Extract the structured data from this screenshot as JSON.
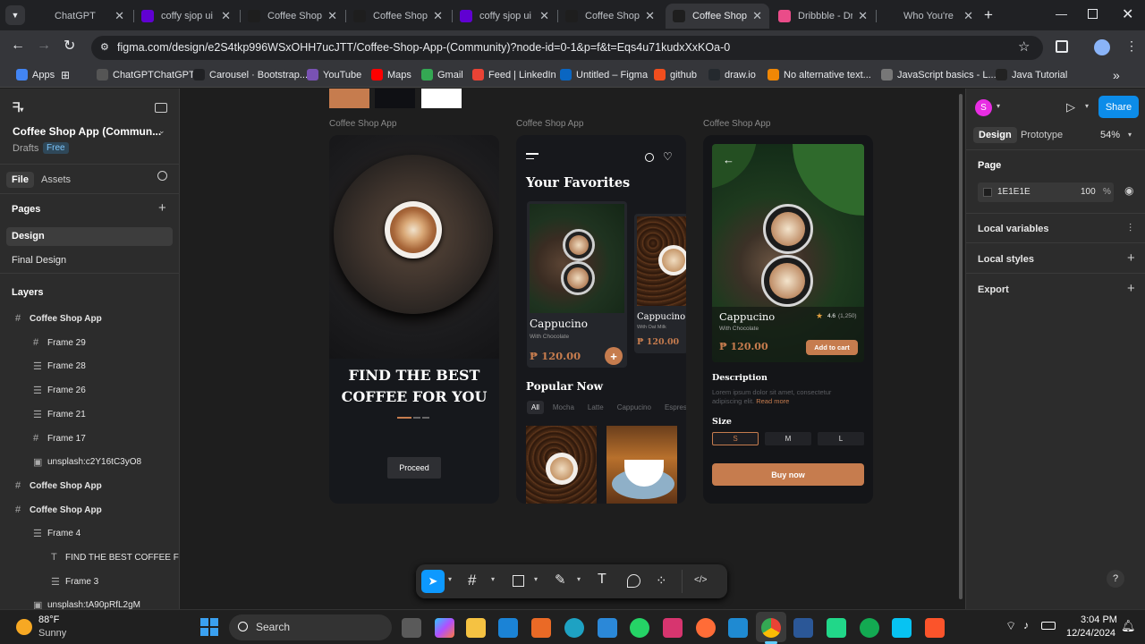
{
  "browser": {
    "tabs": [
      {
        "title": "ChatGPT",
        "color": "#202124"
      },
      {
        "title": "coffy sjop ui",
        "color": "#6001d2"
      },
      {
        "title": "Coffee Shop",
        "color": "#1e1e1e"
      },
      {
        "title": "Coffee Shop",
        "color": "#1e1e1e"
      },
      {
        "title": "coffy sjop ui",
        "color": "#6001d2"
      },
      {
        "title": "Coffee Shop",
        "color": "#1e1e1e"
      },
      {
        "title": "Coffee Shop",
        "color": "#1e1e1e"
      },
      {
        "title": "Dribbble - Dr",
        "color": "#ea4c89"
      },
      {
        "title": "Who You're",
        "color": "#202124"
      }
    ],
    "active_tab": 6,
    "url": "figma.com/design/e2S4tkp996WSxOHH7ucJTT/Coffee-Shop-App-(Community)?node-id=0-1&p=f&t=Eqs4u71kudxXxKOa-0",
    "bookmarks": [
      "Apps",
      "ChatGPTChatGPT",
      "Carousel · Bootstrap...",
      "YouTube",
      "Maps",
      "Gmail",
      "Feed | LinkedIn",
      "Untitled – Figma",
      "github",
      "draw.io",
      "No alternative text...",
      "JavaScript basics - L...",
      "Java Tutorial"
    ],
    "more": "»"
  },
  "left": {
    "file_title": "Coffee Shop App (Commun...",
    "drafts": "Drafts",
    "plan": "Free",
    "tab_file": "File",
    "tab_assets": "Assets",
    "pages_heading": "Pages",
    "pages": [
      "Design",
      "Final Design"
    ],
    "layers_heading": "Layers",
    "layers": [
      {
        "name": "Coffee Shop App",
        "type": "frame",
        "level": 0
      },
      {
        "name": "Frame 29",
        "type": "frame",
        "level": 1
      },
      {
        "name": "Frame 28",
        "type": "autolayout",
        "level": 1
      },
      {
        "name": "Frame 26",
        "type": "autolayout",
        "level": 1
      },
      {
        "name": "Frame 21",
        "type": "autolayout",
        "level": 1
      },
      {
        "name": "Frame 17",
        "type": "frame",
        "level": 1
      },
      {
        "name": "unsplash:c2Y16tC3yO8",
        "type": "image",
        "level": 1
      },
      {
        "name": "Coffee Shop App",
        "type": "frame",
        "level": 0
      },
      {
        "name": "Coffee Shop App",
        "type": "frame",
        "level": 0
      },
      {
        "name": "Frame 4",
        "type": "autolayout",
        "level": 1
      },
      {
        "name": "FIND THE BEST COFFEE FOR",
        "type": "text",
        "level": 2
      },
      {
        "name": "Frame 3",
        "type": "autolayout",
        "level": 2
      },
      {
        "name": "unsplash:tA90pRfL2gM",
        "type": "image",
        "level": 1
      }
    ]
  },
  "canvas": {
    "frame_label": "Coffee Shop App",
    "swatches": [
      "#c67c4e",
      "#0f1014",
      "#ffffff"
    ],
    "onboarding": {
      "headline_1": "FIND THE BEST",
      "headline_2": "COFFEE FOR YOU",
      "proceed": "Proceed"
    },
    "favorites": {
      "title": "Your Favorites",
      "card1": {
        "name": "Cappucino",
        "sub": "With Chocolate",
        "price": "₱ 120.00",
        "add": "+"
      },
      "card2": {
        "name": "Cappucino",
        "sub": "With Oat Milk",
        "price": "₱ 120.00"
      },
      "popular": "Popular Now",
      "chips": [
        "All",
        "Mocha",
        "Latte",
        "Cappucino",
        "Espresso"
      ]
    },
    "detail": {
      "name": "Cappucino",
      "sub": "With Chocolate",
      "rating": "4.6",
      "reviews": "(1,250)",
      "price": "₱ 120.00",
      "add_to_cart": "Add to cart",
      "desc_heading": "Description",
      "desc": "Lorem ipsum dolor sit amet, consectetur adipiscing elit.",
      "read_more": "Read more",
      "size_heading": "Size",
      "sizes": [
        "S",
        "M",
        "L"
      ],
      "buy": "Buy now"
    }
  },
  "toolbar": {
    "code": "</>"
  },
  "right": {
    "avatar": "S",
    "share": "Share",
    "tab_design": "Design",
    "tab_prototype": "Prototype",
    "zoom": "54%",
    "page_heading": "Page",
    "page_color": "1E1E1E",
    "page_opacity": "100",
    "percent": "%",
    "local_variables": "Local variables",
    "local_styles": "Local styles",
    "export": "Export",
    "help": "?"
  },
  "taskbar": {
    "temp": "88°F",
    "weather": "Sunny",
    "search": "Search",
    "time": "3:04 PM",
    "date": "12/24/2024"
  },
  "colors": {
    "accent": "#c67c4e",
    "figma_blue": "#0d99ff",
    "share_blue": "#0c8ce9"
  }
}
